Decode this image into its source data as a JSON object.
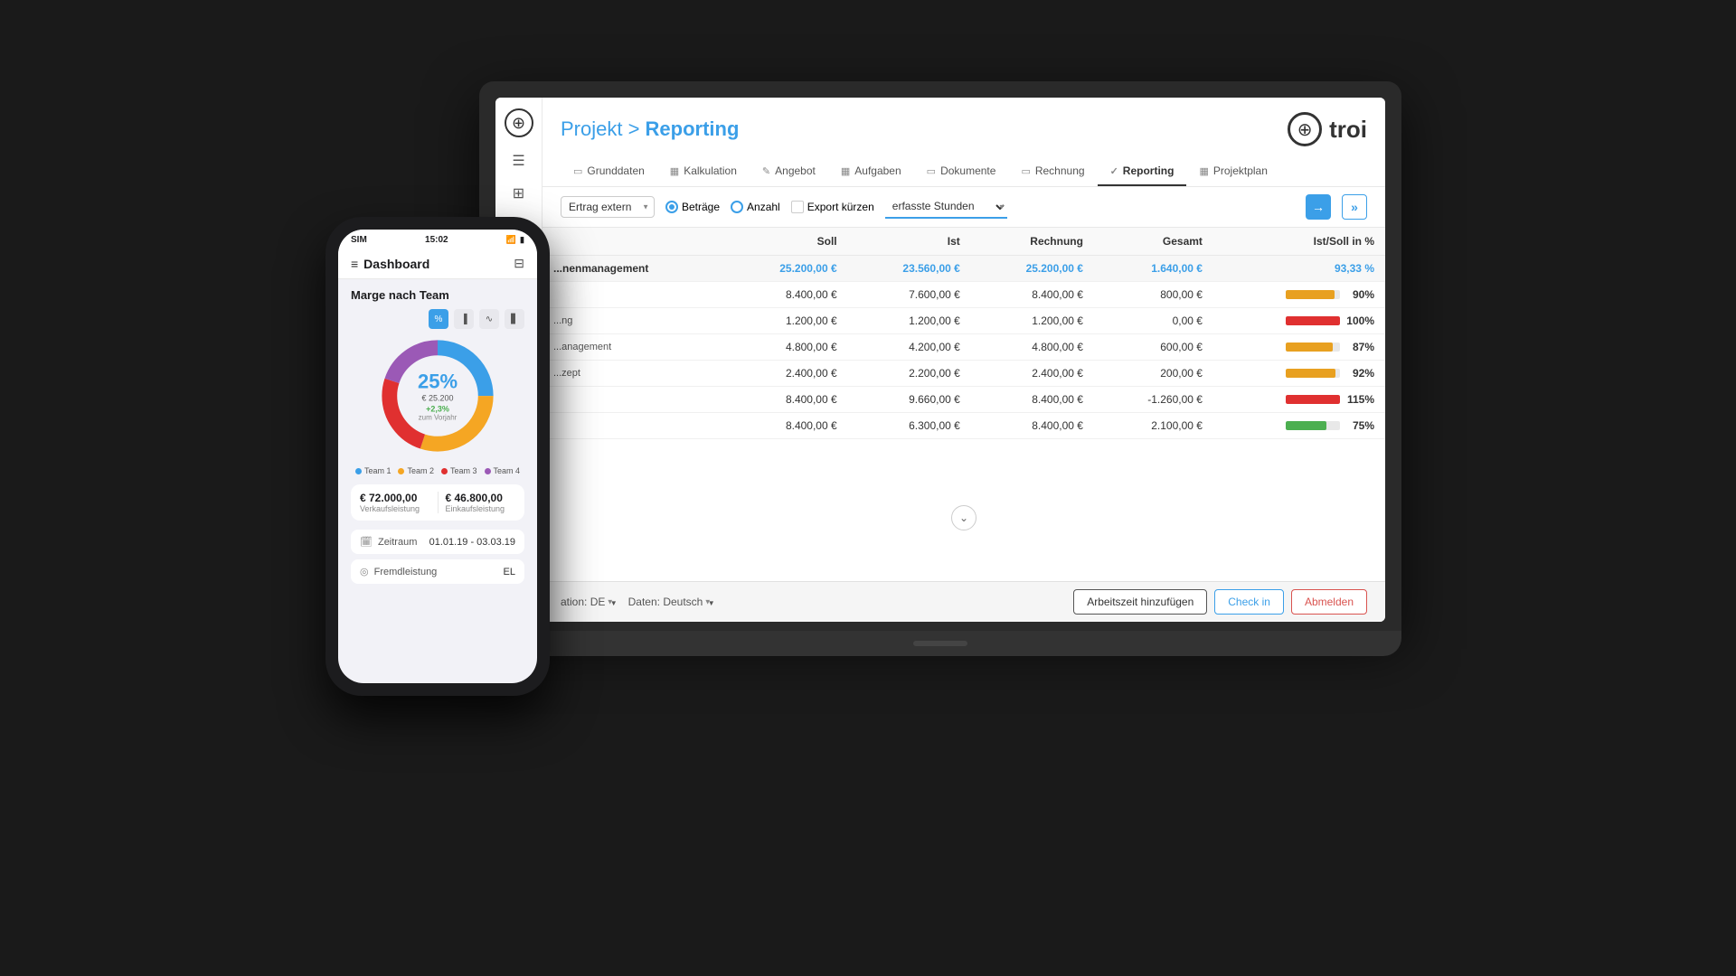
{
  "app": {
    "title_prefix": "Projekt > ",
    "title_highlight": "Reporting",
    "logo_text": "troi",
    "logo_symbol": "⊕"
  },
  "nav": {
    "tabs": [
      {
        "id": "grunddaten",
        "label": "Grunddaten",
        "icon": "▭",
        "active": false
      },
      {
        "id": "kalkulation",
        "label": "Kalkulation",
        "icon": "▦",
        "active": false
      },
      {
        "id": "angebot",
        "label": "Angebot",
        "icon": "✎",
        "active": false
      },
      {
        "id": "aufgaben",
        "label": "Aufgaben",
        "icon": "▦",
        "active": false
      },
      {
        "id": "dokumente",
        "label": "Dokumente",
        "icon": "▭",
        "active": false
      },
      {
        "id": "rechnung",
        "label": "Rechnung",
        "icon": "▭",
        "active": false
      },
      {
        "id": "reporting",
        "label": "Reporting",
        "icon": "✓",
        "active": true
      },
      {
        "id": "projektplan",
        "label": "Projektplan",
        "icon": "▦",
        "active": false
      }
    ]
  },
  "filter": {
    "select_option": "Ertrag extern",
    "radio_betraege": "Beträge",
    "radio_anzahl": "Anzahl",
    "checkbox_export": "Export kürzen",
    "dropdown_stunden": "erfasste Stunden",
    "btn_go": "→",
    "btn_nav": "»"
  },
  "table": {
    "headers": [
      "",
      "Soll",
      "Ist",
      "Rechnung",
      "Gesamt",
      "Ist/Soll in %"
    ],
    "group_row": {
      "label": "...nenmanagement",
      "soll": "25.200,00 €",
      "ist": "23.560,00 €",
      "rechnung": "25.200,00 €",
      "gesamt": "1.640,00 €",
      "pct": "93,33 %",
      "pct_num": 93
    },
    "rows": [
      {
        "label": "",
        "soll": "8.400,00 €",
        "ist": "7.600,00 €",
        "rechnung": "8.400,00 €",
        "gesamt": "800,00 €",
        "pct": "90%",
        "pct_num": 90,
        "color": "#e8a020"
      },
      {
        "label": "...ng",
        "soll": "1.200,00 €",
        "ist": "1.200,00 €",
        "rechnung": "1.200,00 €",
        "gesamt": "0,00 €",
        "pct": "100%",
        "pct_num": 100,
        "color": "#e03030"
      },
      {
        "label": "...anagement",
        "soll": "4.800,00 €",
        "ist": "4.200,00 €",
        "rechnung": "4.800,00 €",
        "gesamt": "600,00 €",
        "pct": "87%",
        "pct_num": 87,
        "color": "#e8a020"
      },
      {
        "label": "...zept",
        "soll": "2.400,00 €",
        "ist": "2.200,00 €",
        "rechnung": "2.400,00 €",
        "gesamt": "200,00 €",
        "pct": "92%",
        "pct_num": 92,
        "color": "#e8a020"
      },
      {
        "label": "",
        "soll": "8.400,00 €",
        "ist": "9.660,00 €",
        "rechnung": "8.400,00 €",
        "gesamt": "-1.260,00 €",
        "pct": "115%",
        "pct_num": 100,
        "color": "#e03030"
      },
      {
        "label": "",
        "soll": "8.400,00 €",
        "ist": "6.300,00 €",
        "rechnung": "8.400,00 €",
        "gesamt": "2.100,00 €",
        "pct": "75%",
        "pct_num": 75,
        "color": "#4caf50"
      }
    ]
  },
  "bottom": {
    "lokation_label": "ation: DE",
    "daten_label": "Daten: Deutsch",
    "btn_arbeitszeit": "Arbeitszeit hinzufügen",
    "btn_checkin": "Check in",
    "btn_abmelden": "Abmelden"
  },
  "phone": {
    "time": "15:02",
    "carrier": "SIM",
    "header_title": "Dashboard",
    "section_title": "Marge nach Team",
    "pct_value": "25%",
    "pct_amount": "€ 25.200",
    "growth": "+2,3%",
    "growth_label": "zum Vorjahr",
    "legend": [
      {
        "label": "Team 1",
        "color": "#3b9fe8"
      },
      {
        "label": "Team 2",
        "color": "#f5a623"
      },
      {
        "label": "Team 3",
        "color": "#e03030"
      },
      {
        "label": "Team 4",
        "color": "#9b59b6"
      }
    ],
    "metrics": [
      {
        "value": "€ 72.000,00",
        "label": "Verkaufsleistung"
      },
      {
        "value": "€ 46.800,00",
        "label": "Einkaufsleistung"
      }
    ],
    "zeitraum_label": "Zeitraum",
    "zeitraum_value": "01.01.19 - 03.03.19",
    "fremd_label": "Fremdleistung",
    "fremd_value": "EL"
  }
}
